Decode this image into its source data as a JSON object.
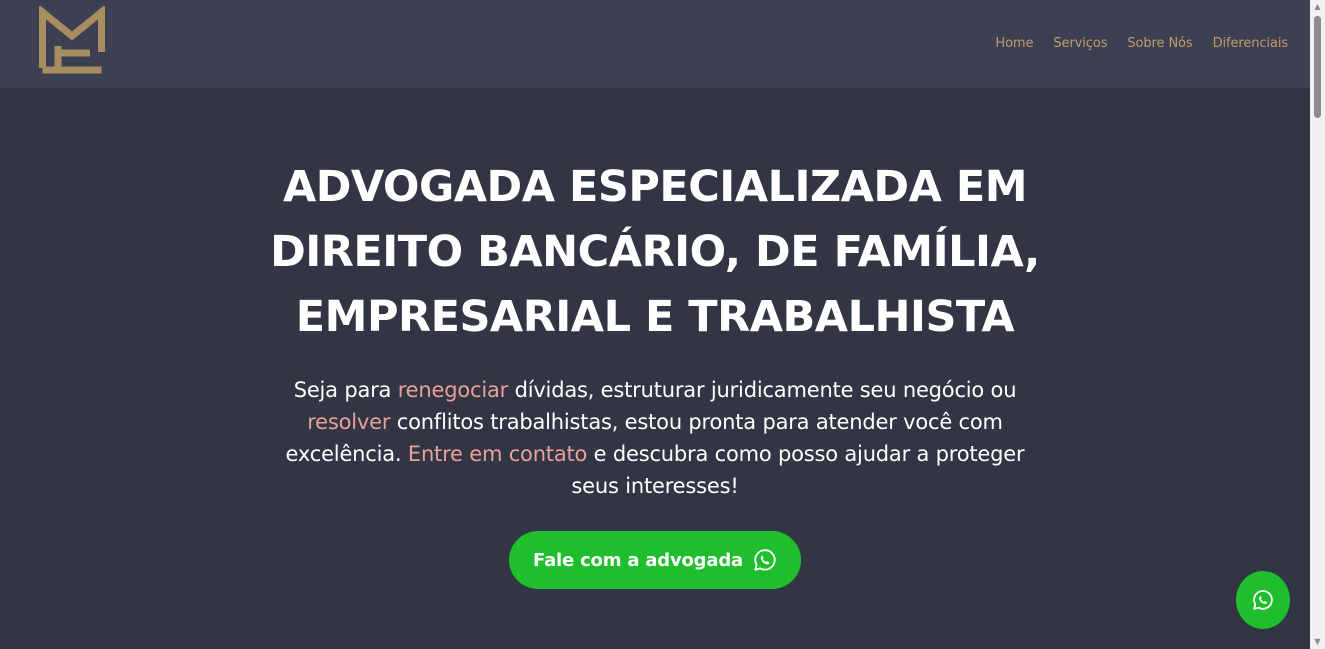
{
  "header": {
    "logo_icon": "mf-monogram-logo",
    "logo_color": "#a88d5f",
    "nav": [
      {
        "label": "Home"
      },
      {
        "label": "Serviços"
      },
      {
        "label": "Sobre Nós"
      },
      {
        "label": "Diferenciais"
      }
    ]
  },
  "hero": {
    "title_lines": [
      "ADVOGADA ESPECIALIZADA EM",
      "DIREITO BANCÁRIO, DE FAMÍLIA,",
      "EMPRESARIAL E TRABALHISTA"
    ],
    "text": {
      "p1": "Seja para ",
      "h1": "renegociar",
      "p2": " dívidas, estruturar juridicamente seu negócio ou ",
      "h2": "resolver",
      "p3": " conflitos trabalhistas, estou pronta para atender você com excelência. ",
      "h3": "Entre em contato",
      "p4": " e descubra como posso ajudar a proteger seus interesses!"
    },
    "cta_label": "Fale com a advogada",
    "cta_icon": "whatsapp-icon"
  },
  "floating_button": {
    "icon": "whatsapp-icon"
  },
  "colors": {
    "background": "#323544",
    "header": "#3d4053",
    "nav_text": "#c29a66",
    "highlight": "#e8a097",
    "whatsapp_green": "#1ebe2c"
  }
}
